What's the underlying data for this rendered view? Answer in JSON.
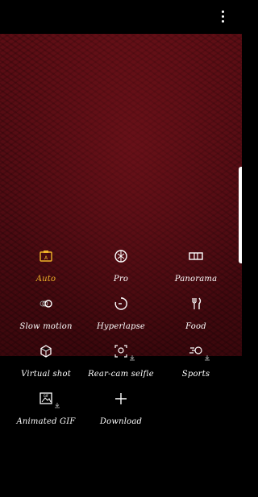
{
  "colors": {
    "active": "#f0b429",
    "text": "#ffffff",
    "viewfinder": "#4f0b12"
  },
  "menu": {
    "icon": "more-vert-icon"
  },
  "modes": [
    {
      "id": "auto",
      "label": "Auto",
      "icon": "camera-auto-icon",
      "active": true
    },
    {
      "id": "pro",
      "label": "Pro",
      "icon": "aperture-icon"
    },
    {
      "id": "panorama",
      "label": "Panorama",
      "icon": "panorama-icon"
    },
    {
      "id": "slow-motion",
      "label": "Slow motion",
      "icon": "slow-motion-icon"
    },
    {
      "id": "hyperlapse",
      "label": "Hyperlapse",
      "icon": "hyperlapse-icon"
    },
    {
      "id": "food",
      "label": "Food",
      "icon": "food-icon"
    },
    {
      "id": "virtual-shot",
      "label": "Virtual shot",
      "icon": "virtual-shot-icon"
    },
    {
      "id": "rear-cam-selfie",
      "label": "Rear-cam selfie",
      "icon": "rear-cam-selfie-icon",
      "download": true
    },
    {
      "id": "sports",
      "label": "Sports",
      "icon": "sports-icon",
      "download": true
    },
    {
      "id": "animated-gif",
      "label": "Animated GIF",
      "icon": "animated-gif-icon",
      "download": true
    },
    {
      "id": "download",
      "label": "Download",
      "icon": "plus-icon"
    }
  ]
}
